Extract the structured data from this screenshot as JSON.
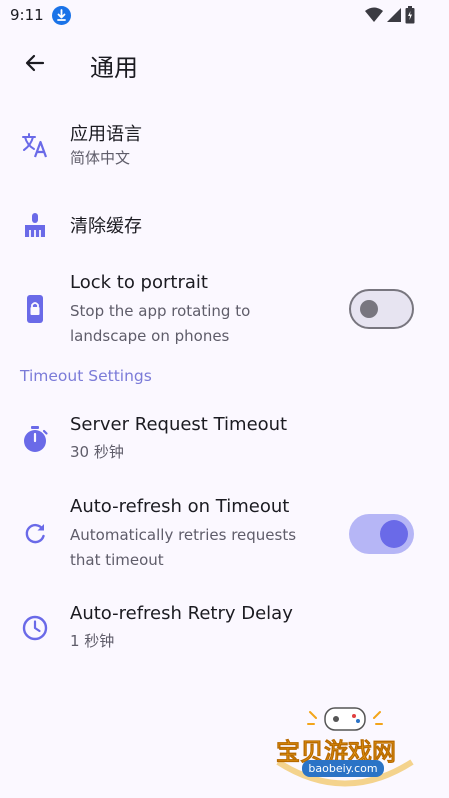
{
  "status_bar": {
    "time": "9:11",
    "icons": [
      "download-notification-icon",
      "wifi-icon",
      "signal-icon",
      "battery-icon"
    ]
  },
  "app_bar": {
    "back_icon": "arrow-back-icon",
    "title": "通用"
  },
  "settings": {
    "language": {
      "icon": "translate-icon",
      "title": "应用语言",
      "subtitle": "简体中文"
    },
    "clear_cache": {
      "icon": "broom-icon",
      "title": "清除缓存"
    },
    "lock_portrait": {
      "icon": "phone-lock-icon",
      "title": "Lock to portrait",
      "subtitle": "Stop the app rotating to landscape on phones",
      "enabled": false
    }
  },
  "timeout_section": {
    "header": "Timeout Settings",
    "server_timeout": {
      "icon": "timer-icon",
      "title": "Server Request Timeout",
      "subtitle": "30 秒钟"
    },
    "auto_refresh": {
      "icon": "refresh-icon",
      "title": "Auto-refresh on Timeout",
      "subtitle": "Automatically retries requests that timeout",
      "enabled": true
    },
    "retry_delay": {
      "icon": "clock-icon",
      "title": "Auto-refresh Retry Delay",
      "subtitle": "1 秒钟"
    }
  },
  "watermark": {
    "text": "宝贝游戏网",
    "url": "baobeiy.com"
  },
  "colors": {
    "background": "#fbf8ff",
    "accent": "#6a6ae8",
    "section_header": "#7b7bd8",
    "icon": "#6a6ae8"
  }
}
